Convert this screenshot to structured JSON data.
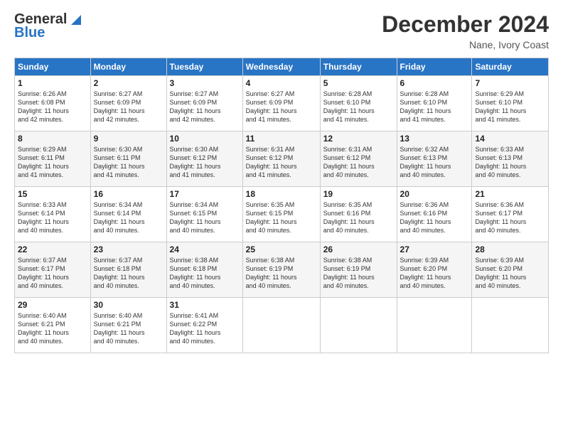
{
  "header": {
    "logo_line1": "General",
    "logo_line2": "Blue",
    "title": "December 2024",
    "subtitle": "Nane, Ivory Coast"
  },
  "days_of_week": [
    "Sunday",
    "Monday",
    "Tuesday",
    "Wednesday",
    "Thursday",
    "Friday",
    "Saturday"
  ],
  "weeks": [
    [
      {
        "day": "1",
        "sunrise": "6:26 AM",
        "sunset": "6:08 PM",
        "daylight": "11 hours and 42 minutes."
      },
      {
        "day": "2",
        "sunrise": "6:27 AM",
        "sunset": "6:09 PM",
        "daylight": "11 hours and 42 minutes."
      },
      {
        "day": "3",
        "sunrise": "6:27 AM",
        "sunset": "6:09 PM",
        "daylight": "11 hours and 42 minutes."
      },
      {
        "day": "4",
        "sunrise": "6:27 AM",
        "sunset": "6:09 PM",
        "daylight": "11 hours and 41 minutes."
      },
      {
        "day": "5",
        "sunrise": "6:28 AM",
        "sunset": "6:10 PM",
        "daylight": "11 hours and 41 minutes."
      },
      {
        "day": "6",
        "sunrise": "6:28 AM",
        "sunset": "6:10 PM",
        "daylight": "11 hours and 41 minutes."
      },
      {
        "day": "7",
        "sunrise": "6:29 AM",
        "sunset": "6:10 PM",
        "daylight": "11 hours and 41 minutes."
      }
    ],
    [
      {
        "day": "8",
        "sunrise": "6:29 AM",
        "sunset": "6:11 PM",
        "daylight": "11 hours and 41 minutes."
      },
      {
        "day": "9",
        "sunrise": "6:30 AM",
        "sunset": "6:11 PM",
        "daylight": "11 hours and 41 minutes."
      },
      {
        "day": "10",
        "sunrise": "6:30 AM",
        "sunset": "6:12 PM",
        "daylight": "11 hours and 41 minutes."
      },
      {
        "day": "11",
        "sunrise": "6:31 AM",
        "sunset": "6:12 PM",
        "daylight": "11 hours and 41 minutes."
      },
      {
        "day": "12",
        "sunrise": "6:31 AM",
        "sunset": "6:12 PM",
        "daylight": "11 hours and 40 minutes."
      },
      {
        "day": "13",
        "sunrise": "6:32 AM",
        "sunset": "6:13 PM",
        "daylight": "11 hours and 40 minutes."
      },
      {
        "day": "14",
        "sunrise": "6:33 AM",
        "sunset": "6:13 PM",
        "daylight": "11 hours and 40 minutes."
      }
    ],
    [
      {
        "day": "15",
        "sunrise": "6:33 AM",
        "sunset": "6:14 PM",
        "daylight": "11 hours and 40 minutes."
      },
      {
        "day": "16",
        "sunrise": "6:34 AM",
        "sunset": "6:14 PM",
        "daylight": "11 hours and 40 minutes."
      },
      {
        "day": "17",
        "sunrise": "6:34 AM",
        "sunset": "6:15 PM",
        "daylight": "11 hours and 40 minutes."
      },
      {
        "day": "18",
        "sunrise": "6:35 AM",
        "sunset": "6:15 PM",
        "daylight": "11 hours and 40 minutes."
      },
      {
        "day": "19",
        "sunrise": "6:35 AM",
        "sunset": "6:16 PM",
        "daylight": "11 hours and 40 minutes."
      },
      {
        "day": "20",
        "sunrise": "6:36 AM",
        "sunset": "6:16 PM",
        "daylight": "11 hours and 40 minutes."
      },
      {
        "day": "21",
        "sunrise": "6:36 AM",
        "sunset": "6:17 PM",
        "daylight": "11 hours and 40 minutes."
      }
    ],
    [
      {
        "day": "22",
        "sunrise": "6:37 AM",
        "sunset": "6:17 PM",
        "daylight": "11 hours and 40 minutes."
      },
      {
        "day": "23",
        "sunrise": "6:37 AM",
        "sunset": "6:18 PM",
        "daylight": "11 hours and 40 minutes."
      },
      {
        "day": "24",
        "sunrise": "6:38 AM",
        "sunset": "6:18 PM",
        "daylight": "11 hours and 40 minutes."
      },
      {
        "day": "25",
        "sunrise": "6:38 AM",
        "sunset": "6:19 PM",
        "daylight": "11 hours and 40 minutes."
      },
      {
        "day": "26",
        "sunrise": "6:38 AM",
        "sunset": "6:19 PM",
        "daylight": "11 hours and 40 minutes."
      },
      {
        "day": "27",
        "sunrise": "6:39 AM",
        "sunset": "6:20 PM",
        "daylight": "11 hours and 40 minutes."
      },
      {
        "day": "28",
        "sunrise": "6:39 AM",
        "sunset": "6:20 PM",
        "daylight": "11 hours and 40 minutes."
      }
    ],
    [
      {
        "day": "29",
        "sunrise": "6:40 AM",
        "sunset": "6:21 PM",
        "daylight": "11 hours and 40 minutes."
      },
      {
        "day": "30",
        "sunrise": "6:40 AM",
        "sunset": "6:21 PM",
        "daylight": "11 hours and 40 minutes."
      },
      {
        "day": "31",
        "sunrise": "6:41 AM",
        "sunset": "6:22 PM",
        "daylight": "11 hours and 40 minutes."
      },
      null,
      null,
      null,
      null
    ]
  ]
}
